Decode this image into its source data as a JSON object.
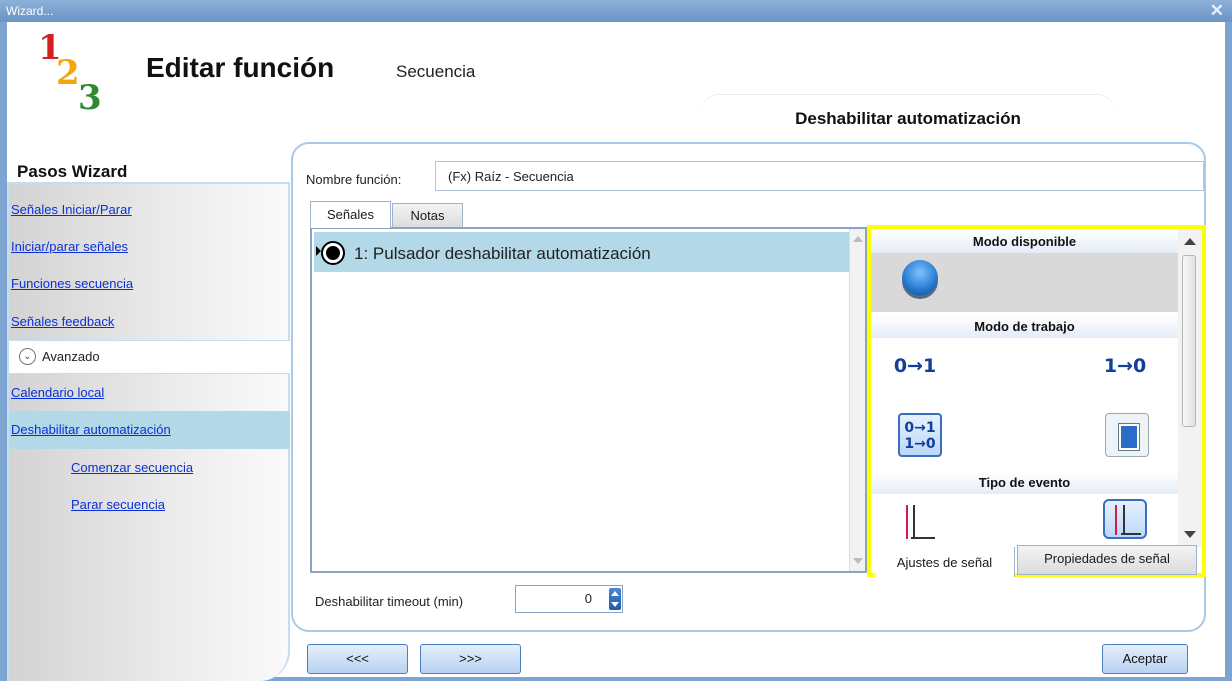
{
  "window": {
    "title": "Wizard...",
    "close_glyph": "✕"
  },
  "logo": {
    "d1": "1",
    "d2": "2",
    "d3": "3"
  },
  "header": {
    "title": "Editar función",
    "subtitle": "Secuencia",
    "section_tab": "Deshabilitar automatización"
  },
  "sidebar": {
    "title": "Pasos Wizard",
    "items": [
      {
        "label": "Señales Iniciar/Parar"
      },
      {
        "label": "Iniciar/parar señales"
      },
      {
        "label": "Funciones secuencia"
      },
      {
        "label": "Señales feedback"
      },
      {
        "label": "Avanzado"
      },
      {
        "label": "Calendario local"
      },
      {
        "label": "Deshabilitar automatización"
      },
      {
        "label": "Comenzar secuencia"
      },
      {
        "label": "Parar secuencia"
      }
    ]
  },
  "form": {
    "name_label": "Nombre función:",
    "name_value": "(Fx) Raíz - Secuencia"
  },
  "tabs": {
    "signals": "Señales",
    "notes": "Notas"
  },
  "signal_list": [
    {
      "label": "1: Pulsador deshabilitar automatización"
    }
  ],
  "properties": {
    "available_mode": "Modo disponible",
    "work_mode": "Modo de trabajo",
    "event_type": "Tipo de evento",
    "work_modes": [
      "0→1",
      "1→0",
      "0→1\n1→0"
    ],
    "tab_settings": "Ajustes de señal",
    "tab_properties": "Propiedades de señal"
  },
  "timeout": {
    "label": "Deshabilitar timeout (min)",
    "value": "0"
  },
  "footer": {
    "prev": "<<<",
    "next": ">>>",
    "accept": "Aceptar"
  },
  "colors": {
    "highlight_border": "#ffff00",
    "selected_row": "#b3d9e9",
    "link": "#0b2fd6",
    "title_bar": "#7ea4d1"
  }
}
